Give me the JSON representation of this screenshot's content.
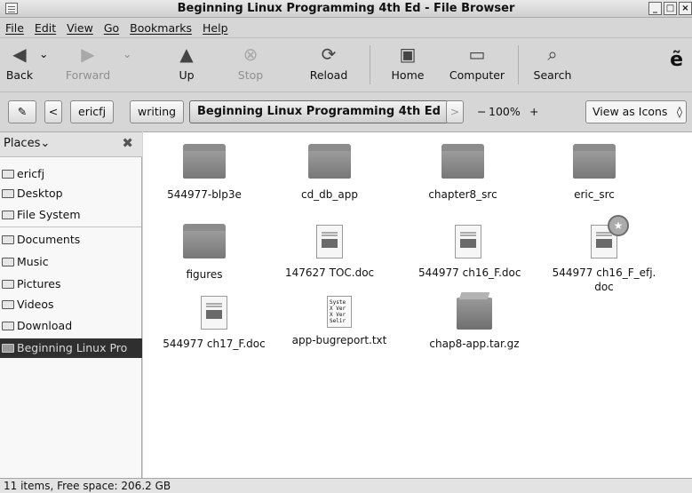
{
  "window": {
    "title": "Beginning Linux Programming 4th Ed - File Browser",
    "minimize": "_",
    "maximize": "□",
    "close": "×"
  },
  "menu": [
    "File",
    "Edit",
    "View",
    "Go",
    "Bookmarks",
    "Help"
  ],
  "toolbar": {
    "back": "Back",
    "forward": "Forward",
    "up": "Up",
    "stop": "Stop",
    "reload": "Reload",
    "home": "Home",
    "computer": "Computer",
    "search": "Search",
    "icons": {
      "back": "◀",
      "forward": "▶",
      "up": "▲",
      "stop": "⊗",
      "reload": "⟳",
      "home": "▣",
      "computer": "▭",
      "search": "⌕",
      "gnome": "ẽ",
      "dropdown": "⌄"
    }
  },
  "location": {
    "crumbs": [
      "ericfj",
      "writing",
      "Beginning Linux Programming 4th Ed"
    ],
    "left_arrow": "<",
    "right_arrow": ">",
    "zoom": "100%",
    "zoom_out_icon": "🔍",
    "view_mode": "View as Icons",
    "view_arrow": "◊"
  },
  "sidebar": {
    "header": "Places",
    "header_arrow": "⌄",
    "close": "✖",
    "items": [
      {
        "label": "ericfj",
        "selected": false
      },
      {
        "label": "Desktop",
        "selected": false
      },
      {
        "label": "File System",
        "selected": false
      },
      {
        "label": "Documents",
        "selected": false
      },
      {
        "label": "Music",
        "selected": false
      },
      {
        "label": "Pictures",
        "selected": false
      },
      {
        "label": "Videos",
        "selected": false
      },
      {
        "label": "Download",
        "selected": false
      },
      {
        "label": "Beginning Linux Pro",
        "selected": true
      }
    ]
  },
  "files": [
    {
      "name": "544977-blp3e",
      "type": "folder"
    },
    {
      "name": "cd_db_app",
      "type": "folder"
    },
    {
      "name": "chapter8_src",
      "type": "folder"
    },
    {
      "name": "eric_src",
      "type": "folder"
    },
    {
      "name": "figures",
      "type": "folder"
    },
    {
      "name": "147627 TOC.doc",
      "type": "document"
    },
    {
      "name": "544977 ch16_F.doc",
      "type": "document"
    },
    {
      "name_line1": "544977 ch16_F_efj.",
      "name_line2": "doc",
      "type": "document",
      "emblem": "★"
    },
    {
      "name": "544977 ch17_F.doc",
      "type": "document"
    },
    {
      "name": "app-bugreport.txt",
      "type": "text",
      "preview": [
        "Syste",
        "X Ver",
        "X Ver",
        "Selir"
      ]
    },
    {
      "name": "chap8-app.tar.gz",
      "type": "archive"
    }
  ],
  "status": "11 items, Free space: 206.2 GB"
}
